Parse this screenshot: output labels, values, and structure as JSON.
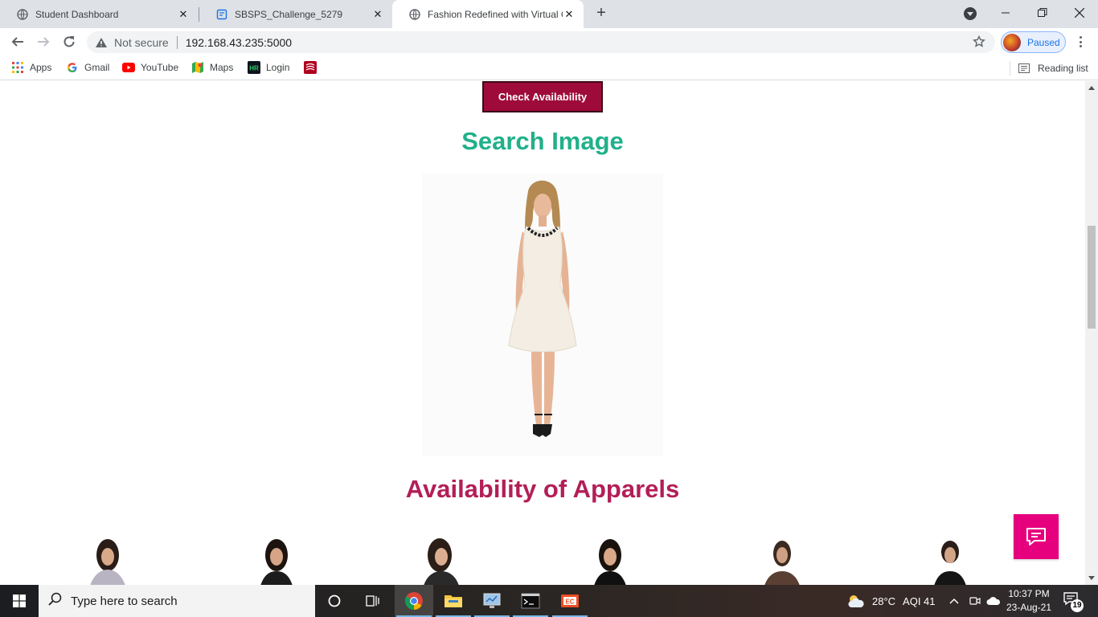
{
  "tabs": [
    {
      "title": "Student Dashboard",
      "icon": "globe-icon"
    },
    {
      "title": "SBSPS_Challenge_5279",
      "icon": "doc-icon"
    },
    {
      "title": "Fashion Redefined with Virtual Gl",
      "icon": "globe-icon",
      "active": true
    }
  ],
  "address": {
    "security": "Not secure",
    "url": "192.168.43.235:5000"
  },
  "profile": {
    "status": "Paused"
  },
  "bookmarks": [
    {
      "label": "Apps",
      "icon": "apps-grid-icon"
    },
    {
      "label": "Gmail",
      "icon": "google-icon"
    },
    {
      "label": "YouTube",
      "icon": "youtube-icon"
    },
    {
      "label": "Maps",
      "icon": "maps-icon"
    },
    {
      "label": "Login",
      "icon": "hackerrank-icon"
    },
    {
      "label": "",
      "icon": "red-book-icon"
    }
  ],
  "reading_list": "Reading list",
  "page": {
    "check_button": "Check Availability",
    "search_heading": "Search Image",
    "availability_heading": "Availability of Apparels"
  },
  "taskbar": {
    "search_placeholder": "Type here to search",
    "weather": "28°C",
    "aqi": "AQI 41",
    "time": "10:37 PM",
    "date": "23-Aug-21",
    "notifications": "19"
  },
  "colors": {
    "accent_green": "#21b08a",
    "accent_maroon": "#b31e56",
    "button_bg": "#9e0b3a",
    "chat_pink": "#e6007e"
  }
}
